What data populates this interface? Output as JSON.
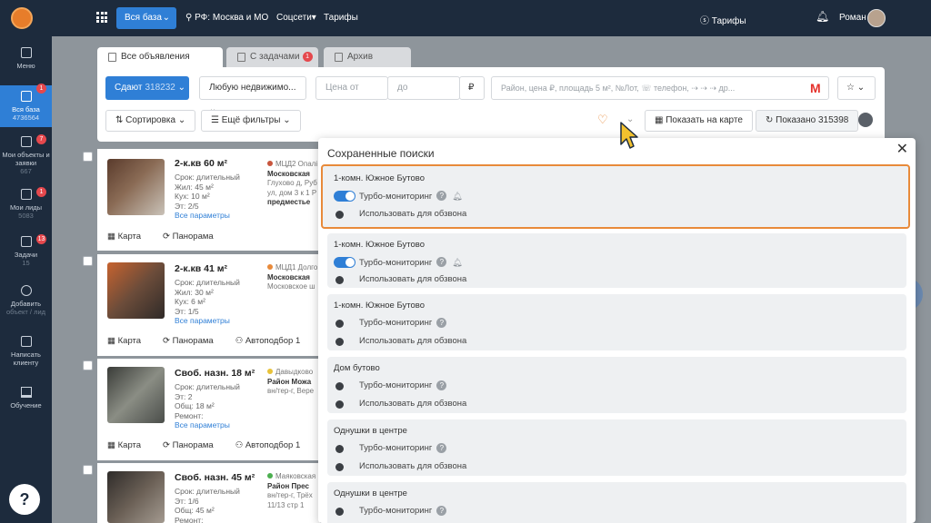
{
  "topbar": {
    "base_btn": "Вся база",
    "region": "РФ: Москва и МО",
    "social": "Соцсети",
    "tariffs": "Тарифы",
    "tariffs_right": "Тарифы",
    "user": "Роман"
  },
  "sidebar": {
    "items": [
      {
        "label": "Меню",
        "sub": ""
      },
      {
        "label": "Вся база",
        "sub": "4736564",
        "badge": "1"
      },
      {
        "label": "Мои объекты и заявки",
        "sub": "667",
        "badge": "7"
      },
      {
        "label": "Мои лиды",
        "sub": "5083",
        "badge": "1"
      },
      {
        "label": "Задачи",
        "sub": "15",
        "badge": "13"
      },
      {
        "label": "Добавить",
        "sub": "объект / лид"
      },
      {
        "label": "Написать клиенту",
        "sub": ""
      },
      {
        "label": "Обучение",
        "sub": ""
      }
    ],
    "help": "?"
  },
  "tabs": [
    {
      "label": "Все объявления"
    },
    {
      "label": "С задачами",
      "badge": "1"
    },
    {
      "label": "Архив"
    }
  ],
  "filters": {
    "deal": "Сдают",
    "deal_count": "318232",
    "property": "Любую недвижимо...",
    "price_from": "Цена от",
    "price_to": "до",
    "currency": "₽",
    "search_placeholder": "Район, цена ₽, площадь 5 м², №Лот, ☏ телефон, ⇢ ⇢ ⇢ др...",
    "sort": "Сортировка",
    "more_filters": "Ещё фильтры",
    "show_map": "Показать на карте",
    "shown": "Показано 315398"
  },
  "listings": [
    {
      "title": "2-к.кв 60 м²",
      "details": [
        "Срок: длительный",
        "Жил: 45 м²",
        "Кух: 10 м²",
        "Эт: 2/5"
      ],
      "link": "Все параметры",
      "metro": "МЦД2 Опалі",
      "metro_color": "#c8553d",
      "addr": [
        "Московская",
        "Глухово д, Руб",
        "ул, дом 3 к 1 Р",
        "предместье"
      ],
      "footer": [
        "Карта",
        "Панорама"
      ]
    },
    {
      "title": "2-к.кв 41 м²",
      "details": [
        "Срок: длительный",
        "Жил: 30 м²",
        "Кух: 6 м²",
        "Эт: 1/5"
      ],
      "link": "Все параметры",
      "metro": "МЦД1 Долго",
      "metro_color": "#e88a3a",
      "addr": [
        "Московская",
        "Московское ш"
      ],
      "footer": [
        "Карта",
        "Панорама",
        "Автоподбор 1"
      ]
    },
    {
      "title": "Своб. назн. 18 м²",
      "details": [
        "Срок: длительный",
        "Эт: 2",
        "Общ: 18 м²",
        "Ремонт:"
      ],
      "link": "Все параметры",
      "metro": "Давыдково",
      "metro_color": "#e8c23a",
      "addr": [
        "Район Можа",
        "вн/тер-г, Вере"
      ],
      "footer": [
        "Карта",
        "Панорама",
        "Автоподбор 1"
      ]
    },
    {
      "title": "Своб. назн. 45 м²",
      "details": [
        "Срок: длительный",
        "Эт: 1/6",
        "Общ: 45 м²",
        "Ремонт:"
      ],
      "link": "",
      "metro": "Маяковская",
      "metro_color": "#4caf50",
      "addr": [
        "Район Прес",
        "вн/тер-г, Трёх",
        "11/13 стр 1"
      ],
      "footer": []
    }
  ],
  "modal": {
    "title": "Сохраненные поиски",
    "close": "✕",
    "turbo_label": "Турбо-мониторинг",
    "call_label": "Использовать для обзвона",
    "searches": [
      {
        "name": "1-комн. Южное Бутово",
        "turbo": true,
        "bell": true,
        "call": false
      },
      {
        "name": "1-комн. Южное Бутово",
        "turbo": true,
        "bell": true,
        "call": false
      },
      {
        "name": "1-комн. Южное Бутово",
        "turbo": false,
        "bell": false,
        "call": false
      },
      {
        "name": "Дом бутово",
        "turbo": false,
        "bell": false,
        "call": false
      },
      {
        "name": "Однушки в центре",
        "turbo": false,
        "bell": false,
        "call": false
      },
      {
        "name": "Однушки в центре",
        "turbo": false,
        "bell": false,
        "call": false
      }
    ]
  },
  "colors": {
    "accent": "#2f7fd6",
    "topbar": "#1d2b3d",
    "highlight": "#e88a3a"
  }
}
